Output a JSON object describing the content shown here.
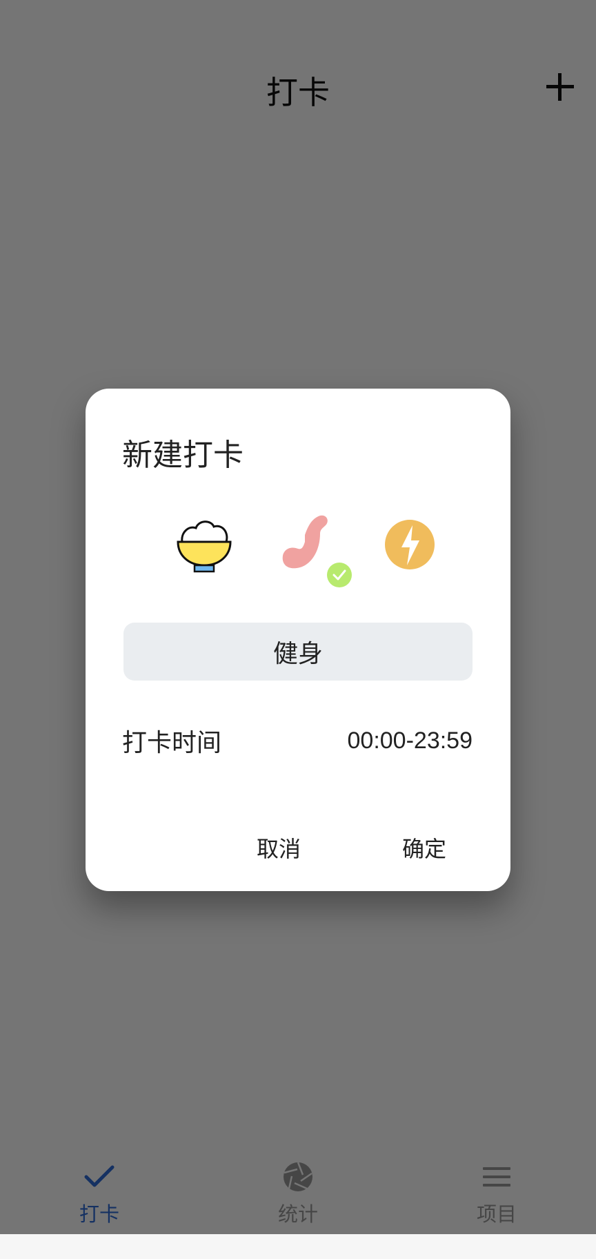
{
  "header": {
    "title": "打卡",
    "add_icon": "plus-icon"
  },
  "tabbar": {
    "tabs": [
      {
        "label": "打卡",
        "icon": "check-icon",
        "active": true
      },
      {
        "label": "统计",
        "icon": "aperture-icon",
        "active": false
      },
      {
        "label": "项目",
        "icon": "menu-icon",
        "active": false
      }
    ]
  },
  "dialog": {
    "title": "新建打卡",
    "icon_options": [
      {
        "icon": "rice-bowl-icon",
        "selected": false
      },
      {
        "icon": "muscle-arm-icon",
        "selected": true
      },
      {
        "icon": "lightning-icon",
        "selected": false
      }
    ],
    "name_value": "健身",
    "time_label": "打卡时间",
    "time_value": "00:00-23:59",
    "cancel_label": "取消",
    "confirm_label": "确定"
  },
  "colors": {
    "accent": "#2f6bd6",
    "scrim": "rgba(0,0,0,0.54)",
    "selected_badge": "#b8ea6e",
    "field_bg": "#eaedf0"
  }
}
